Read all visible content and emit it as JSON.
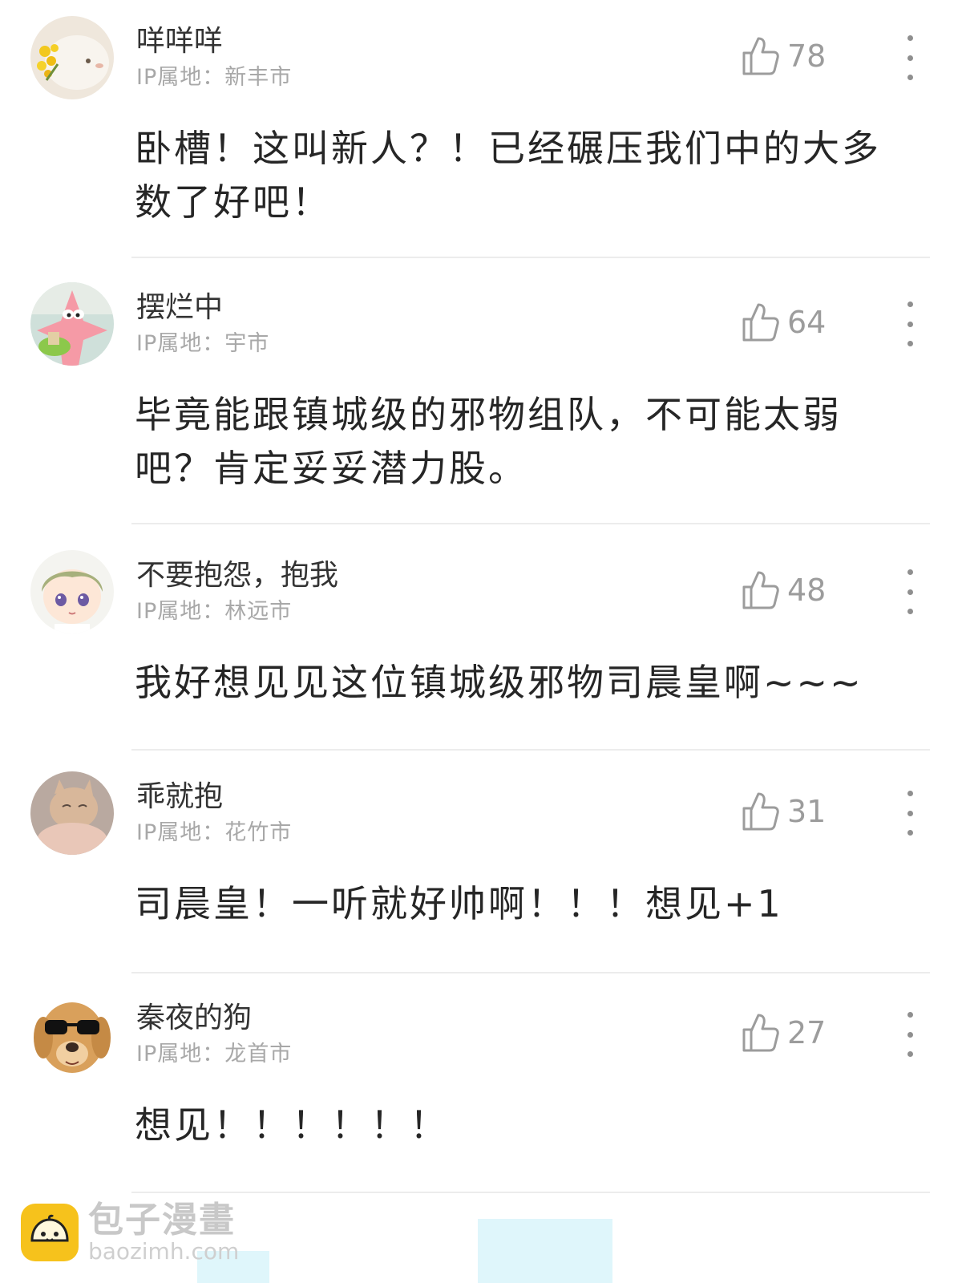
{
  "comments": [
    {
      "username": "咩咩咩",
      "ip": "IP属地：新丰市",
      "likes": "78",
      "text": "卧槽！这叫新人？！已经碾压我们中的大多数了好吧！",
      "avatar_icon": "bunny-flower-avatar"
    },
    {
      "username": "摆烂中",
      "ip": "IP属地：宇市",
      "likes": "64",
      "text": "毕竟能跟镇城级的邪物组队，不可能太弱吧？肯定妥妥潜力股。",
      "avatar_icon": "patrick-star-avatar"
    },
    {
      "username": "不要抱怨，抱我",
      "ip": "IP属地：林远市",
      "likes": "48",
      "text": "我好想见见这位镇城级邪物司晨皇啊~~~",
      "avatar_icon": "anime-kid-avatar"
    },
    {
      "username": "乖就抱",
      "ip": "IP属地：花竹市",
      "likes": "31",
      "text": "司晨皇！一听就好帅啊！！！想见+1",
      "avatar_icon": "cat-hug-avatar"
    },
    {
      "username": "秦夜的狗",
      "ip": "IP属地：龙首市",
      "likes": "27",
      "text": "想见！！！！！！",
      "avatar_icon": "dog-sunglasses-avatar"
    }
  ],
  "watermark": {
    "name": "包子漫畫",
    "url": "baozimh.com"
  },
  "colors": {
    "divider": "#ececec",
    "secondary_text": "#a8a8a8",
    "logo": "#f6c21c"
  }
}
